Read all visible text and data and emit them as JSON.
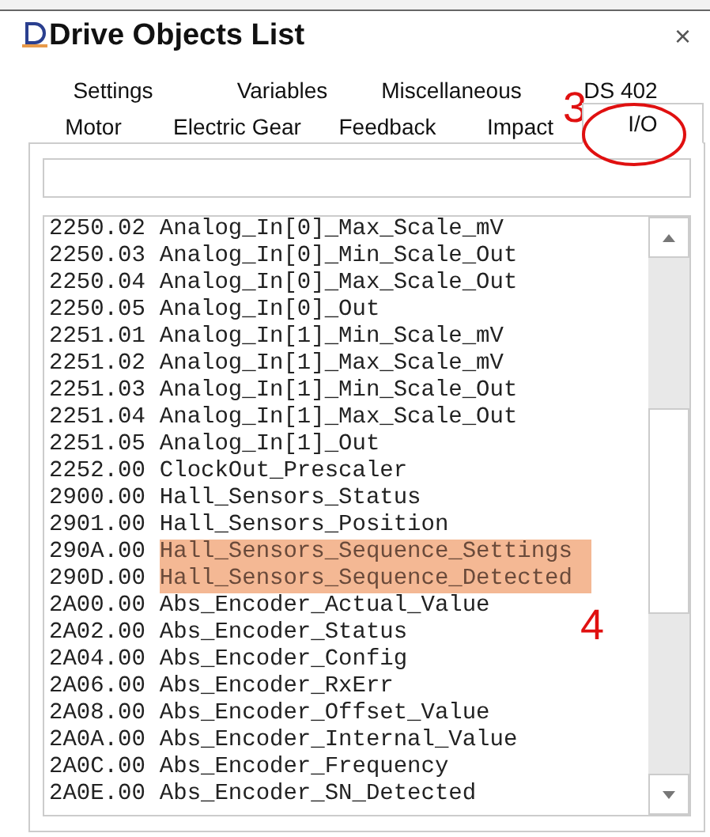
{
  "window": {
    "title": "Drive Objects List",
    "close": "×"
  },
  "tab_rows": [
    [
      {
        "label": "Settings",
        "selected": false
      },
      {
        "label": "Variables",
        "selected": false
      },
      {
        "label": "Miscellaneous",
        "selected": false
      },
      {
        "label": "DS 402",
        "selected": false
      }
    ],
    [
      {
        "label": "Motor",
        "selected": false
      },
      {
        "label": "Electric Gear",
        "selected": false
      },
      {
        "label": "Feedback",
        "selected": false
      },
      {
        "label": "Impact",
        "selected": false
      },
      {
        "label": "I/O",
        "selected": true
      }
    ]
  ],
  "annotations": [
    {
      "kind": "tab-marker",
      "text": "3"
    },
    {
      "kind": "list-marker",
      "text": "4"
    }
  ],
  "objects": [
    {
      "code": "2250.02",
      "name": "Analog_In[0]_Max_Scale_mV",
      "highlighted": false
    },
    {
      "code": "2250.03",
      "name": "Analog_In[0]_Min_Scale_Out",
      "highlighted": false
    },
    {
      "code": "2250.04",
      "name": "Analog_In[0]_Max_Scale_Out",
      "highlighted": false
    },
    {
      "code": "2250.05",
      "name": "Analog_In[0]_Out",
      "highlighted": false
    },
    {
      "code": "2251.01",
      "name": "Analog_In[1]_Min_Scale_mV",
      "highlighted": false
    },
    {
      "code": "2251.02",
      "name": "Analog_In[1]_Max_Scale_mV",
      "highlighted": false
    },
    {
      "code": "2251.03",
      "name": "Analog_In[1]_Min_Scale_Out",
      "highlighted": false
    },
    {
      "code": "2251.04",
      "name": "Analog_In[1]_Max_Scale_Out",
      "highlighted": false
    },
    {
      "code": "2251.05",
      "name": "Analog_In[1]_Out",
      "highlighted": false
    },
    {
      "code": "2252.00",
      "name": "ClockOut_Prescaler",
      "highlighted": false
    },
    {
      "code": "2900.00",
      "name": "Hall_Sensors_Status",
      "highlighted": false
    },
    {
      "code": "2901.00",
      "name": "Hall_Sensors_Position",
      "highlighted": false
    },
    {
      "code": "290A.00",
      "name": "Hall_Sensors_Sequence_Settings",
      "highlighted": true
    },
    {
      "code": "290D.00",
      "name": "Hall_Sensors_Sequence_Detected",
      "highlighted": true
    },
    {
      "code": "2A00.00",
      "name": "Abs_Encoder_Actual_Value",
      "highlighted": false
    },
    {
      "code": "2A02.00",
      "name": "Abs_Encoder_Status",
      "highlighted": false
    },
    {
      "code": "2A04.00",
      "name": "Abs_Encoder_Config",
      "highlighted": false
    },
    {
      "code": "2A06.00",
      "name": "Abs_Encoder_RxErr",
      "highlighted": false
    },
    {
      "code": "2A08.00",
      "name": "Abs_Encoder_Offset_Value",
      "highlighted": false
    },
    {
      "code": "2A0A.00",
      "name": "Abs_Encoder_Internal_Value",
      "highlighted": false
    },
    {
      "code": "2A0C.00",
      "name": "Abs_Encoder_Frequency",
      "highlighted": false
    },
    {
      "code": "2A0E.00",
      "name": "Abs_Encoder_SN_Detected",
      "highlighted": false
    }
  ]
}
